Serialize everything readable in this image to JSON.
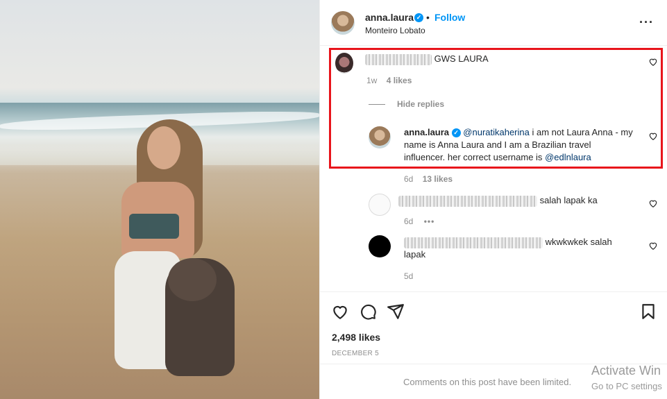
{
  "post": {
    "username": "anna.laura",
    "follow_label": "Follow",
    "location": "Monteiro Lobato",
    "separator": "•"
  },
  "comments": [
    {
      "text": "GWS LAURA",
      "time": "1w",
      "likes": "4 likes",
      "hide_replies": "Hide replies"
    },
    {
      "username": "anna.laura",
      "mention": "@nuratikaherina",
      "text": "i am not Laura Anna - my name is Anna Laura and I am a Brazilian travel influencer. her correct username is",
      "mention2": "@edlnlaura",
      "time": "6d",
      "likes": "13 likes"
    },
    {
      "text": "salah lapak ka",
      "time": "6d",
      "more": "•••"
    },
    {
      "text_line1": "wkwkwkek salah",
      "text_line2": "lapak",
      "time": "5d"
    }
  ],
  "footer": {
    "likes": "2,498 likes",
    "date": "DECEMBER 5",
    "limited": "Comments on this post have been limited."
  },
  "watermark": {
    "line1": "Activate Win",
    "line2": "Go to PC settings"
  },
  "colors": {
    "accent": "#0095f6",
    "highlight": "#e8141b"
  }
}
